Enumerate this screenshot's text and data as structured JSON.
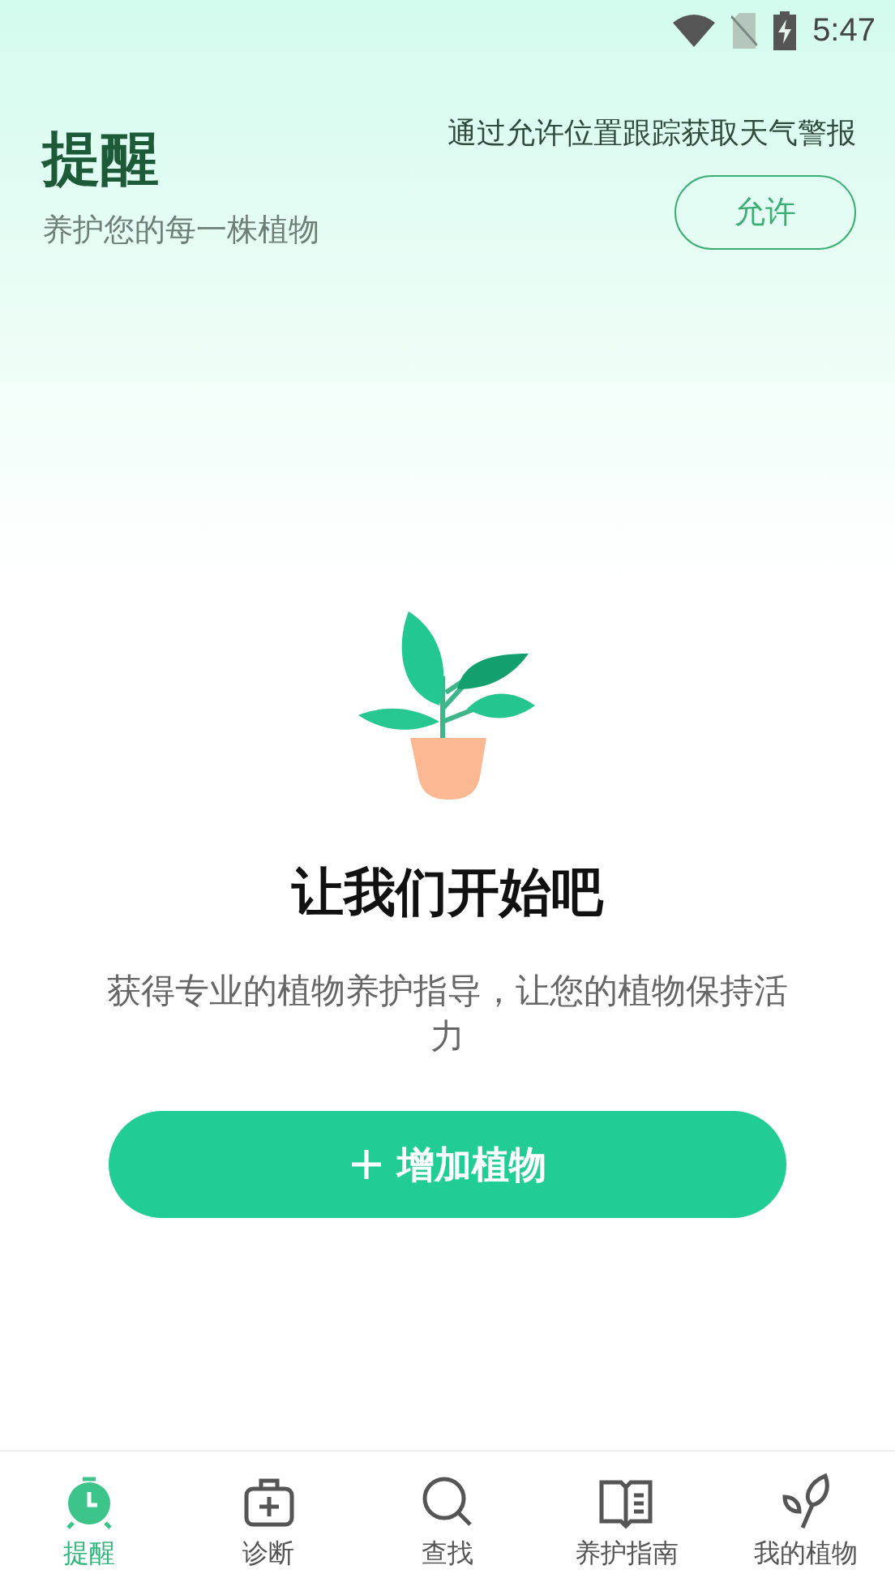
{
  "status_bar": {
    "time": "5:47"
  },
  "header": {
    "title": "提醒",
    "subtitle": "养护您的每一株植物",
    "location_prompt": "通过允许位置跟踪获取天气警报",
    "allow_button": "允许"
  },
  "empty_state": {
    "heading": "让我们开始吧",
    "description": "获得专业的植物养护指导，让您的植物保持活力",
    "add_button": "增加植物"
  },
  "bottom_nav": [
    {
      "label": "提醒",
      "kind": "alarm",
      "selected": true
    },
    {
      "label": "诊断",
      "kind": "kit",
      "selected": false
    },
    {
      "label": "查找",
      "kind": "search",
      "selected": false
    },
    {
      "label": "养护指南",
      "kind": "book",
      "selected": false
    },
    {
      "label": "我的植物",
      "kind": "plant",
      "selected": false
    }
  ]
}
